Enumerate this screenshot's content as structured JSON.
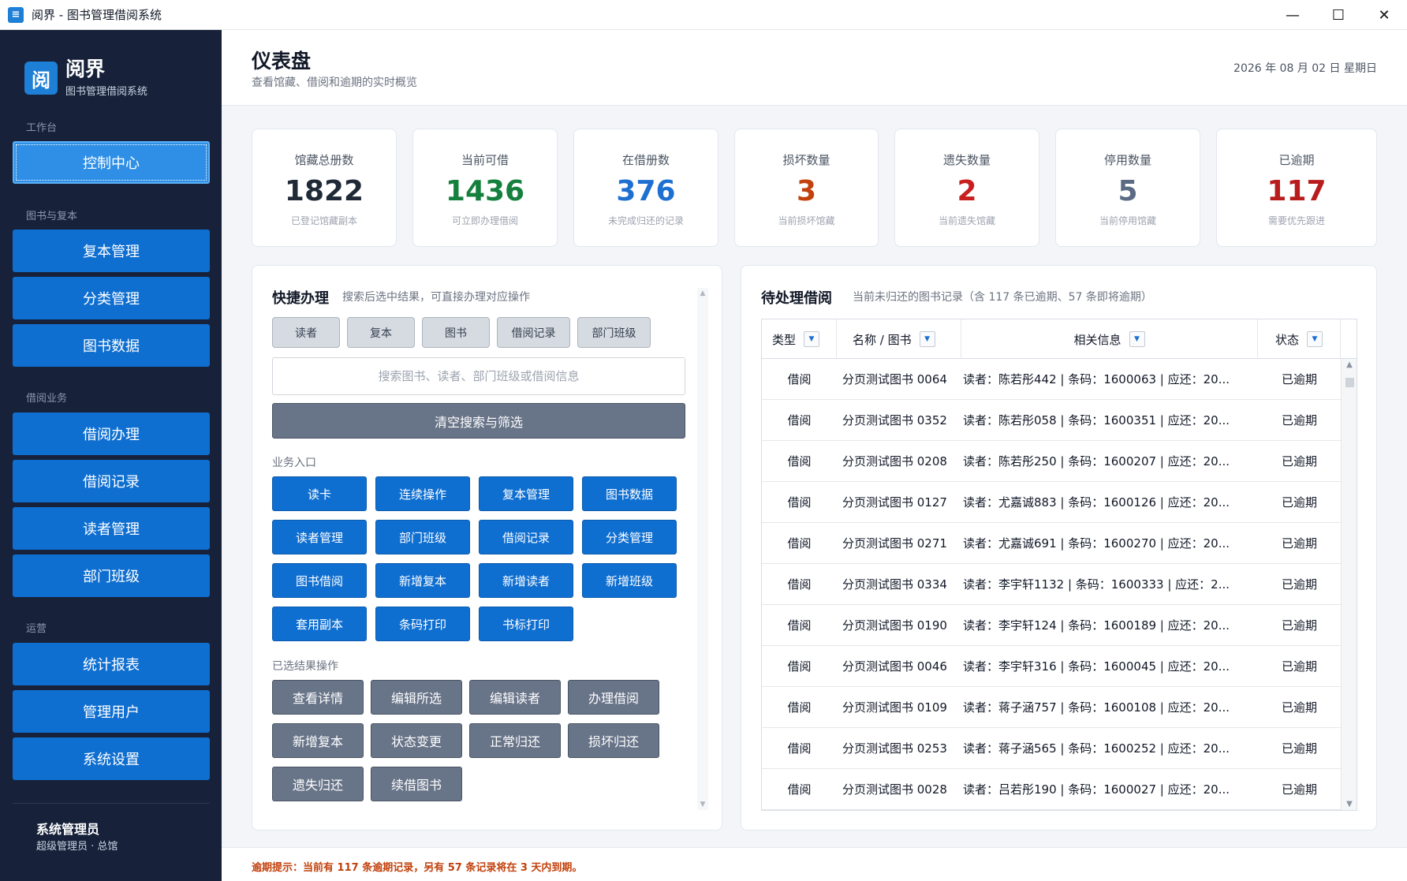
{
  "window": {
    "app_icon": "book-icon",
    "title": "阅界 - 图书管理借阅系统",
    "minimize": "—",
    "maximize": "☐",
    "close": "✕"
  },
  "sidebar": {
    "logo_char": "阅",
    "brand_name": "阅界",
    "brand_sub": "图书管理借阅系统",
    "sections": {
      "workbench": "工作台",
      "books": "图书与复本",
      "borrow": "借阅业务",
      "ops": "运营"
    },
    "items": {
      "control_center": "控制中心",
      "copy_manage": "复本管理",
      "category_manage": "分类管理",
      "book_data": "图书数据",
      "borrow_handle": "借阅办理",
      "borrow_records": "借阅记录",
      "reader_manage": "读者管理",
      "department_class": "部门班级",
      "stats_report": "统计报表",
      "manage_users": "管理用户",
      "system_settings": "系统设置"
    },
    "active_item": "控制中心",
    "user": {
      "name": "系统管理员",
      "role": "超级管理员 · 总馆"
    }
  },
  "header": {
    "title": "仪表盘",
    "subtitle": "查看馆藏、借阅和逾期的实时概览",
    "date": "2026 年 08 月 02 日 星期日"
  },
  "stats": [
    {
      "label": "馆藏总册数",
      "value": "1822",
      "hint": "已登记馆藏副本",
      "color": "#1f2937"
    },
    {
      "label": "当前可借",
      "value": "1436",
      "hint": "可立即办理借阅",
      "color": "#15803d"
    },
    {
      "label": "在借册数",
      "value": "376",
      "hint": "未完成归还的记录",
      "color": "#1d6fd1"
    },
    {
      "label": "损坏数量",
      "value": "3",
      "hint": "当前损坏馆藏",
      "color": "#c2410c"
    },
    {
      "label": "遗失数量",
      "value": "2",
      "hint": "当前遗失馆藏",
      "color": "#c81e1e"
    },
    {
      "label": "停用数量",
      "value": "5",
      "hint": "当前停用馆藏",
      "color": "#5b6b84"
    },
    {
      "label": "已逾期",
      "value": "117",
      "hint": "需要优先跟进",
      "color": "#b91c1c"
    }
  ],
  "quick": {
    "title": "快捷办理",
    "subtitle": "搜索后选中结果，可直接办理对应操作",
    "filters": [
      "读者",
      "复本",
      "图书",
      "借阅记录",
      "部门班级"
    ],
    "search_placeholder": "搜索图书、读者、部门班级或借阅信息",
    "search_value": "",
    "clear_label": "清空搜索与筛选",
    "entry_label": "业务入口",
    "entries": [
      "读卡",
      "连续操作",
      "复本管理",
      "图书数据",
      "读者管理",
      "部门班级",
      "借阅记录",
      "分类管理",
      "图书借阅",
      "新增复本",
      "新增读者",
      "新增班级",
      "套用副本",
      "条码打印",
      "书标打印"
    ],
    "selected_label": "已选结果操作",
    "selected_actions": [
      "查看详情",
      "编辑所选",
      "编辑读者",
      "办理借阅",
      "新增复本",
      "状态变更",
      "正常归还",
      "损坏归还",
      "遗失归还",
      "续借图书"
    ],
    "scroll_up": "▲",
    "scroll_down": "▼"
  },
  "pending": {
    "title": "待处理借阅",
    "subtitle": "当前未归还的图书记录（含 117 条已逾期、57 条即将逾期）",
    "columns": [
      "类型",
      "名称 / 图书",
      "相关信息",
      "状态"
    ],
    "filter_icon": "▼",
    "rows": [
      {
        "type": "借阅",
        "name": "分页测试图书 0064",
        "info": "读者：陈若彤442 | 条码：1600063 | 应还：20...",
        "status": "已逾期"
      },
      {
        "type": "借阅",
        "name": "分页测试图书 0352",
        "info": "读者：陈若彤058 | 条码：1600351 | 应还：20...",
        "status": "已逾期"
      },
      {
        "type": "借阅",
        "name": "分页测试图书 0208",
        "info": "读者：陈若彤250 | 条码：1600207 | 应还：20...",
        "status": "已逾期"
      },
      {
        "type": "借阅",
        "name": "分页测试图书 0127",
        "info": "读者：尤嘉诚883 | 条码：1600126 | 应还：20...",
        "status": "已逾期"
      },
      {
        "type": "借阅",
        "name": "分页测试图书 0271",
        "info": "读者：尤嘉诚691 | 条码：1600270 | 应还：20...",
        "status": "已逾期"
      },
      {
        "type": "借阅",
        "name": "分页测试图书 0334",
        "info": "读者：李宇轩1132 | 条码：1600333 | 应还：2...",
        "status": "已逾期"
      },
      {
        "type": "借阅",
        "name": "分页测试图书 0190",
        "info": "读者：李宇轩124 | 条码：1600189 | 应还：20...",
        "status": "已逾期"
      },
      {
        "type": "借阅",
        "name": "分页测试图书 0046",
        "info": "读者：李宇轩316 | 条码：1600045 | 应还：20...",
        "status": "已逾期"
      },
      {
        "type": "借阅",
        "name": "分页测试图书 0109",
        "info": "读者：蒋子涵757 | 条码：1600108 | 应还：20...",
        "status": "已逾期"
      },
      {
        "type": "借阅",
        "name": "分页测试图书 0253",
        "info": "读者：蒋子涵565 | 条码：1600252 | 应还：20...",
        "status": "已逾期"
      },
      {
        "type": "借阅",
        "name": "分页测试图书 0028",
        "info": "读者：吕若彤190 | 条码：1600027 | 应还：20...",
        "status": "已逾期"
      }
    ],
    "scroll_up": "▲",
    "scroll_down": "▼"
  },
  "footer": {
    "notice": "逾期提示：当前有 117 条逾期记录，另有 57 条记录将在 3 天内到期。"
  }
}
